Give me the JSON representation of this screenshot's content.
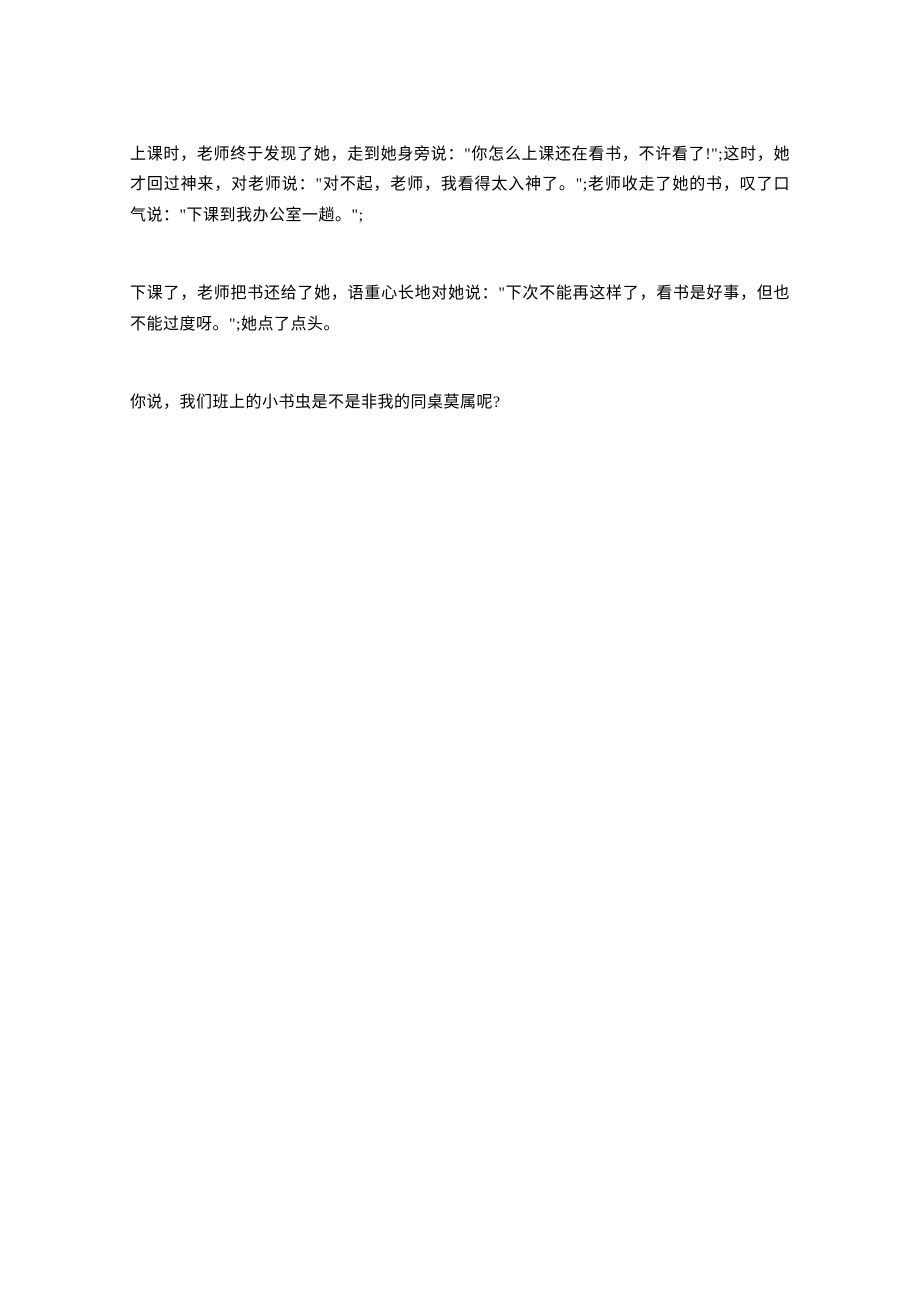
{
  "paragraphs": [
    "上课时，老师终于发现了她，走到她身旁说：\"你怎么上课还在看书，不许看了!\";这时，她才回过神来，对老师说：\"对不起，老师，我看得太入神了。\";老师收走了她的书，叹了口气说：\"下课到我办公室一趟。\";",
    "下课了，老师把书还给了她，语重心长地对她说：\"下次不能再这样了，看书是好事，但也不能过度呀。\";她点了点头。",
    "你说，我们班上的小书虫是不是非我的同桌莫属呢?"
  ]
}
